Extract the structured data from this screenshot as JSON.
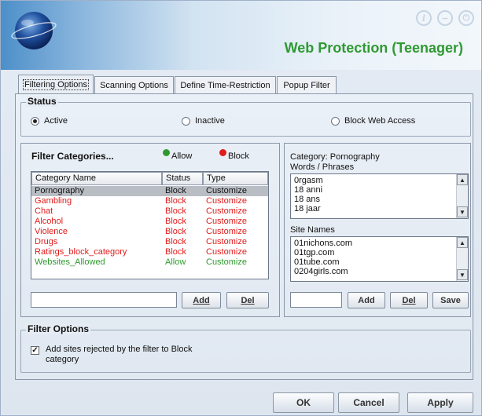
{
  "window": {
    "title": "Web Protection (Teenager)",
    "icons": [
      "info-icon",
      "minimize-icon",
      "power-icon"
    ]
  },
  "tabs": [
    {
      "label": "Filtering Options",
      "active": true
    },
    {
      "label": "Scanning Options",
      "active": false
    },
    {
      "label": "Define Time-Restriction",
      "active": false
    },
    {
      "label": "Popup Filter",
      "active": false
    }
  ],
  "status": {
    "legend": "Status",
    "options": [
      {
        "label": "Active",
        "selected": true
      },
      {
        "label": "Inactive",
        "selected": false
      },
      {
        "label": "Block Web Access",
        "selected": false
      }
    ]
  },
  "filter_categories": {
    "title": "Filter Categories...",
    "allow_label": "Allow",
    "block_label": "Block",
    "allow_color": "#2e9a2e",
    "block_color": "#e21b1b",
    "columns": [
      "Category Name",
      "Status",
      "Type"
    ],
    "rows": [
      {
        "name": "Pornography",
        "status": "Block",
        "type": "Customize",
        "color": "#111111",
        "selected": true
      },
      {
        "name": "Gambling",
        "status": "Block",
        "type": "Customize",
        "color": "#e21b1b"
      },
      {
        "name": "Chat",
        "status": "Block",
        "type": "Customize",
        "color": "#e21b1b"
      },
      {
        "name": "Alcohol",
        "status": "Block",
        "type": "Customize",
        "color": "#e21b1b"
      },
      {
        "name": "Violence",
        "status": "Block",
        "type": "Customize",
        "color": "#e21b1b"
      },
      {
        "name": "Drugs",
        "status": "Block",
        "type": "Customize",
        "color": "#e21b1b"
      },
      {
        "name": "Ratings_block_category",
        "status": "Block",
        "type": "Customize",
        "color": "#e21b1b"
      },
      {
        "name": "Websites_Allowed",
        "status": "Allow",
        "type": "Customize",
        "color": "#2e9a2e"
      }
    ],
    "input_value": "",
    "add_label": "Add",
    "del_label": "Del"
  },
  "category_detail": {
    "category_label": "Category: Pornography",
    "words_label": "Words / Phrases",
    "words": [
      "0rgasm",
      "18 anni",
      "18 ans",
      "18 jaar"
    ],
    "sites_label": "Site Names",
    "sites": [
      "01nichons.com",
      "01tgp.com",
      "01tube.com",
      "0204girls.com"
    ],
    "input_value": "",
    "add_label": "Add",
    "del_label": "Del",
    "save_label": "Save"
  },
  "filter_options": {
    "legend": "Filter Options",
    "checkbox_label_line1": "Add sites rejected by the filter to Block",
    "checkbox_label_line2": "category",
    "checked": true
  },
  "footer": {
    "ok_label": "OK",
    "cancel_label": "Cancel",
    "apply_label": "Apply"
  }
}
